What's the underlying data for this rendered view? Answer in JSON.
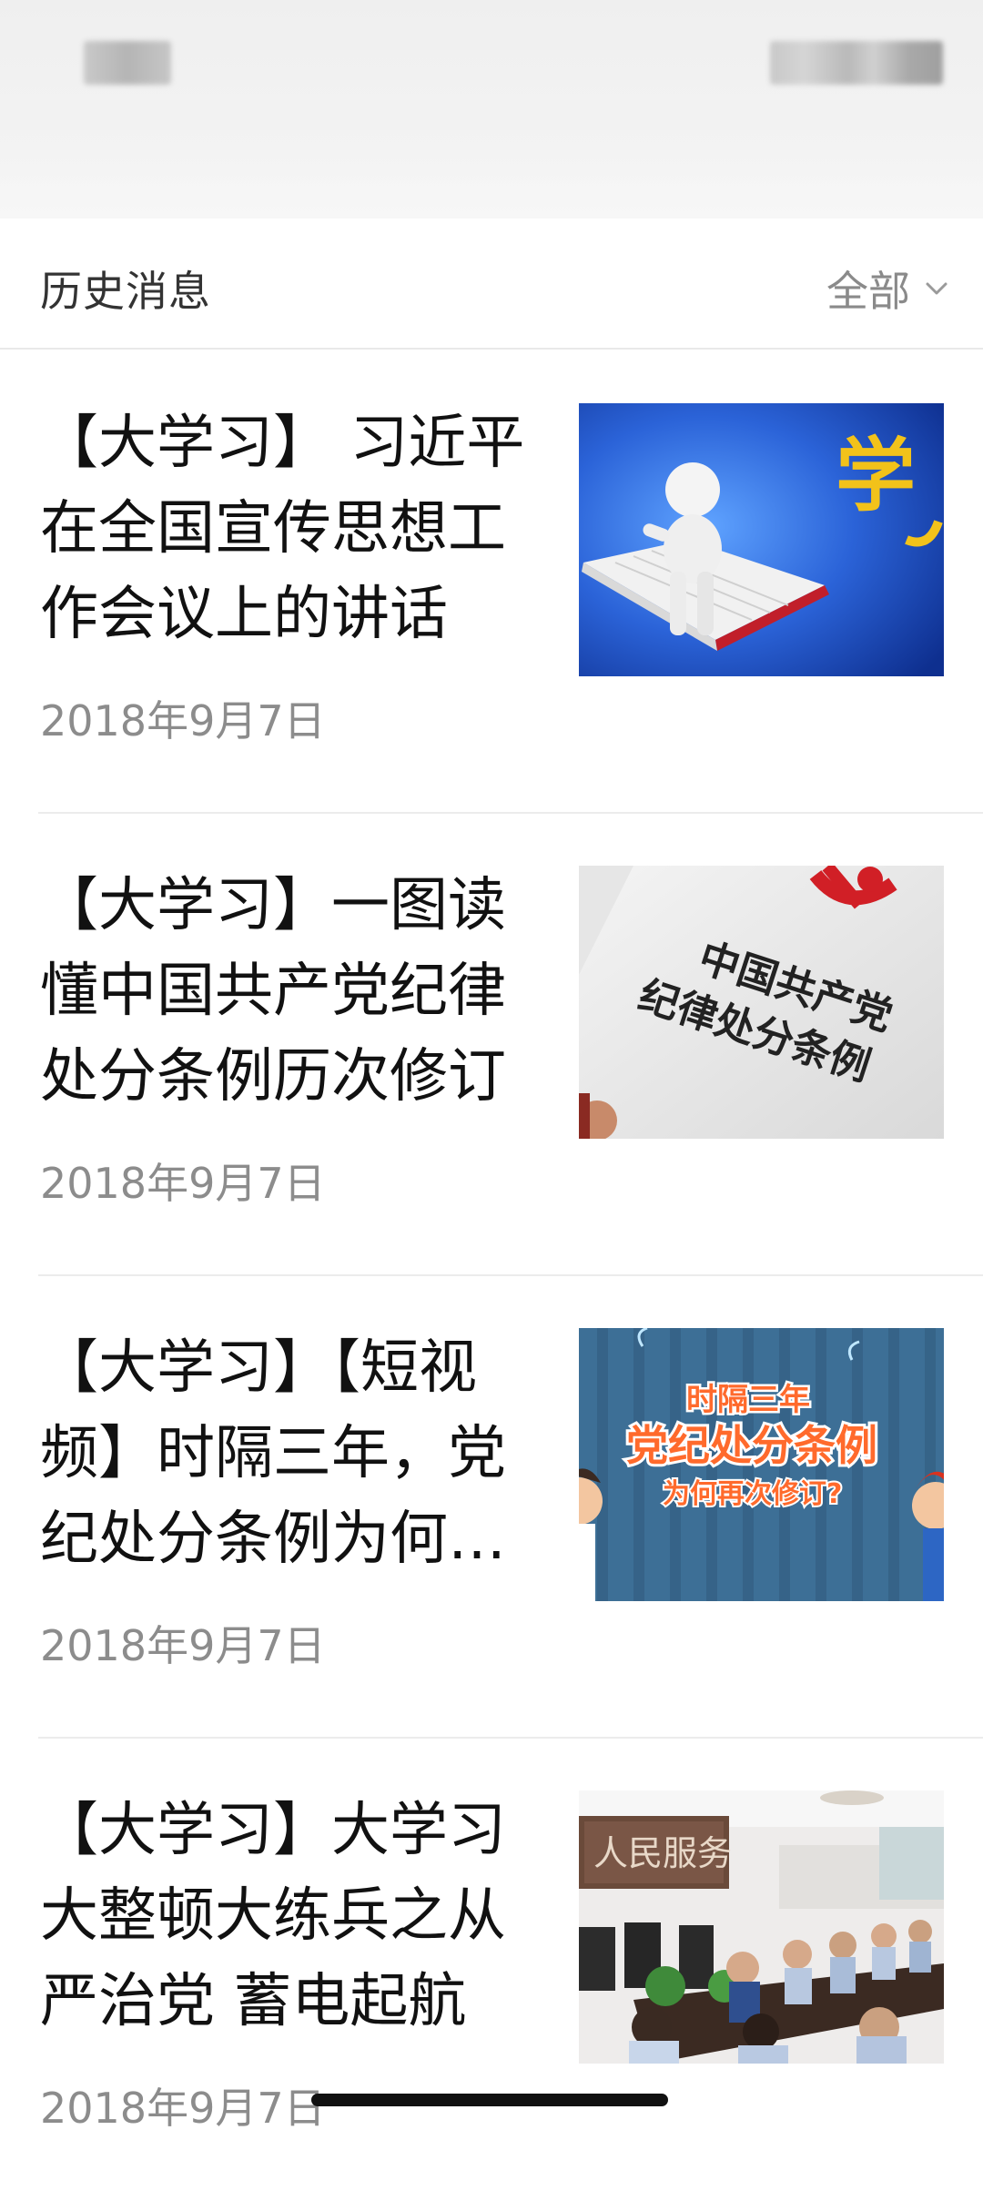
{
  "header": {
    "history_label": "历史消息",
    "filter_label": "全部"
  },
  "articles": [
    {
      "title": "【大学习】 习近平在全国宣传思想工作会议上的讲话",
      "date": "2018年9月7日",
      "thumb_text": "学"
    },
    {
      "title": "【大学习】一图读懂中国共产党纪律处分条例历次修订",
      "date": "2018年9月7日",
      "thumb_text_line1": "中国共产党",
      "thumb_text_line2": "纪律处分条例"
    },
    {
      "title": "【大学习】【短视频】时隔三年，党纪处分条例为何再次修订",
      "date": "2018年9月7日",
      "thumb_text_line1": "时隔三年",
      "thumb_text_line2": "党纪处分条例",
      "thumb_text_line3": "为何再次修订?"
    },
    {
      "title": "【大学习】大学习大整顿大练兵之从严治党 蓄电起航",
      "date": "2018年9月7日",
      "thumb_text": "人民服务"
    }
  ],
  "colors": {
    "accent_blue": "#1f4fbf",
    "party_red": "#c8202a",
    "poster_orange": "#ff6a2c",
    "text_primary": "#111111",
    "text_secondary": "#8c8c8c"
  }
}
